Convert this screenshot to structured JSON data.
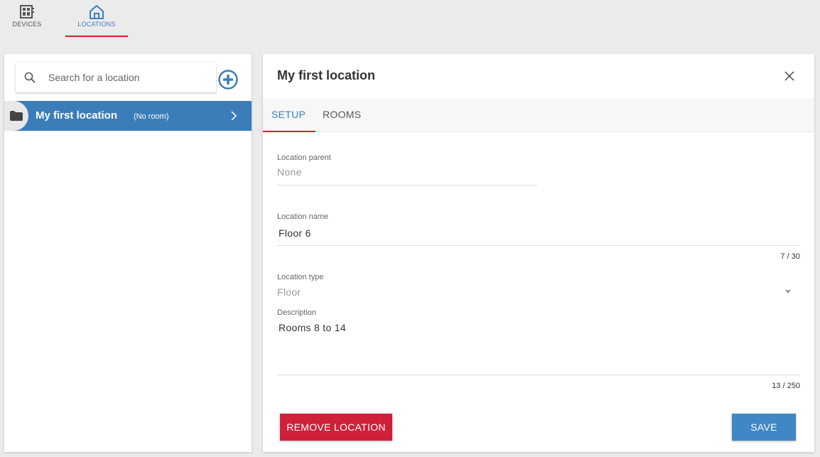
{
  "nav": {
    "devices": {
      "label": "DEVICES",
      "icon": "devices-icon"
    },
    "locations": {
      "label": "LOCATIONS",
      "icon": "home-icon"
    }
  },
  "sidebar": {
    "search_placeholder": "Search for a location",
    "items": [
      {
        "name": "My first location",
        "sub": "(No room)",
        "icon": "folder-icon"
      }
    ]
  },
  "panel": {
    "title": "My first location",
    "tabs": [
      {
        "label": "SETUP",
        "active": true
      },
      {
        "label": "ROOMS",
        "active": false
      }
    ],
    "fields": {
      "parent": {
        "label": "Location parent",
        "value": "None"
      },
      "name": {
        "label": "Location name",
        "value": "Floor 6",
        "counter": "7 / 30"
      },
      "type": {
        "label": "Location type",
        "value": "Floor"
      },
      "description": {
        "label": "Description",
        "value": "Rooms 8 to 14",
        "counter": "13 / 250"
      }
    },
    "buttons": {
      "remove": "REMOVE LOCATION",
      "save": "SAVE"
    }
  },
  "colors": {
    "accent_blue": "#3b7db8",
    "accent_red": "#d01f3b",
    "background": "#ebebeb"
  }
}
